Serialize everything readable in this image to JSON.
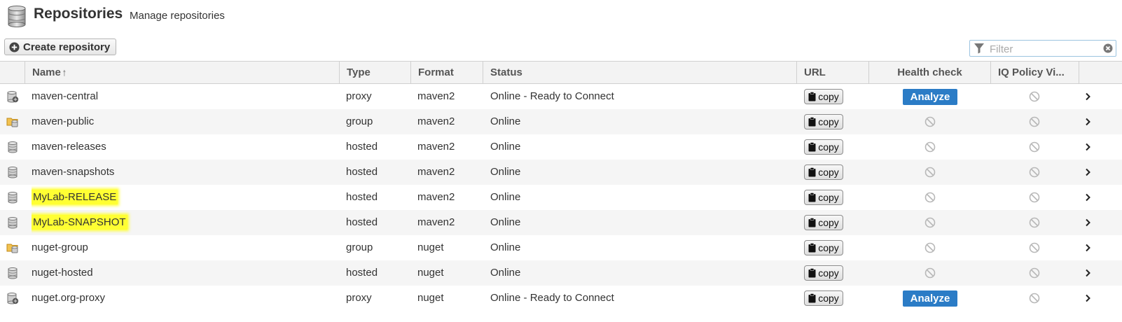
{
  "header": {
    "title": "Repositories",
    "subtitle": "Manage repositories"
  },
  "toolbar": {
    "create_label": "Create repository",
    "filter_placeholder": "Filter",
    "filter_value": ""
  },
  "columns": {
    "name": "Name",
    "type": "Type",
    "format": "Format",
    "status": "Status",
    "url": "URL",
    "health": "Health check",
    "iq": "IQ Policy Vi..."
  },
  "sort": {
    "column": "Name",
    "direction": "ascending"
  },
  "colors": {
    "accent": "#2b7cc6",
    "highlight": "#ffff33",
    "header_bg": "#f3f3f3",
    "alt_row": "#f5f5f5"
  },
  "rows": [
    {
      "icon": "proxy-repo-icon",
      "name": "maven-central",
      "highlighted": false,
      "type": "proxy",
      "format": "maven2",
      "status": "Online - Ready to Connect",
      "url_label": "copy",
      "health": "Analyze",
      "iq": ""
    },
    {
      "icon": "group-repo-icon",
      "name": "maven-public",
      "highlighted": false,
      "type": "group",
      "format": "maven2",
      "status": "Online",
      "url_label": "copy",
      "health": "",
      "iq": ""
    },
    {
      "icon": "hosted-repo-icon",
      "name": "maven-releases",
      "highlighted": false,
      "type": "hosted",
      "format": "maven2",
      "status": "Online",
      "url_label": "copy",
      "health": "",
      "iq": ""
    },
    {
      "icon": "hosted-repo-icon",
      "name": "maven-snapshots",
      "highlighted": false,
      "type": "hosted",
      "format": "maven2",
      "status": "Online",
      "url_label": "copy",
      "health": "",
      "iq": ""
    },
    {
      "icon": "hosted-repo-icon",
      "name": "MyLab-RELEASE",
      "highlighted": true,
      "type": "hosted",
      "format": "maven2",
      "status": "Online",
      "url_label": "copy",
      "health": "",
      "iq": ""
    },
    {
      "icon": "hosted-repo-icon",
      "name": "MyLab-SNAPSHOT",
      "highlighted": true,
      "type": "hosted",
      "format": "maven2",
      "status": "Online",
      "url_label": "copy",
      "health": "",
      "iq": ""
    },
    {
      "icon": "group-repo-icon",
      "name": "nuget-group",
      "highlighted": false,
      "type": "group",
      "format": "nuget",
      "status": "Online",
      "url_label": "copy",
      "health": "",
      "iq": ""
    },
    {
      "icon": "hosted-repo-icon",
      "name": "nuget-hosted",
      "highlighted": false,
      "type": "hosted",
      "format": "nuget",
      "status": "Online",
      "url_label": "copy",
      "health": "",
      "iq": ""
    },
    {
      "icon": "proxy-repo-icon",
      "name": "nuget.org-proxy",
      "highlighted": false,
      "type": "proxy",
      "format": "nuget",
      "status": "Online - Ready to Connect",
      "url_label": "copy",
      "health": "Analyze",
      "iq": ""
    }
  ]
}
